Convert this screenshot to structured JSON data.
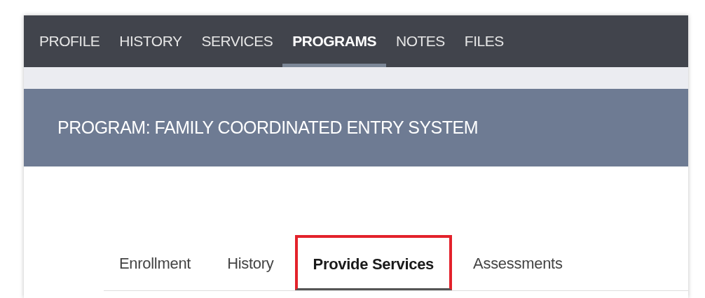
{
  "nav_tabs": [
    {
      "label": "PROFILE",
      "selected": false
    },
    {
      "label": "HISTORY",
      "selected": false
    },
    {
      "label": "SERVICES",
      "selected": false
    },
    {
      "label": "PROGRAMS",
      "selected": true
    },
    {
      "label": "NOTES",
      "selected": false
    },
    {
      "label": "FILES",
      "selected": false
    }
  ],
  "program_header": {
    "title": "PROGRAM: FAMILY COORDINATED ENTRY SYSTEM"
  },
  "program_tabs": [
    {
      "label": "Enrollment",
      "selected": false,
      "highlighted": false
    },
    {
      "label": "History",
      "selected": false,
      "highlighted": false
    },
    {
      "label": "Provide Services",
      "selected": true,
      "highlighted": true
    },
    {
      "label": "Assessments",
      "selected": false,
      "highlighted": false
    }
  ]
}
